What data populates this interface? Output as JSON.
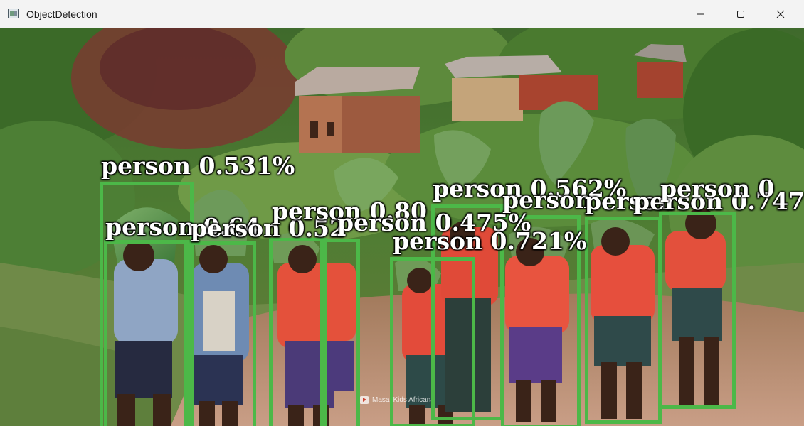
{
  "window": {
    "title": "ObjectDetection",
    "icon": "app-icon",
    "controls": [
      "minimize-icon",
      "maximize-icon",
      "close-icon"
    ]
  },
  "video": {
    "watermark": "Masai Kids Africana"
  },
  "detections": [
    {
      "label": "person 0.531%"
    },
    {
      "label": "person 0.64"
    },
    {
      "label": "person 0.52"
    },
    {
      "label": "person 0.80"
    },
    {
      "label": "person 0.475%"
    },
    {
      "label": "person 0.721%"
    },
    {
      "label": "person 0.562%"
    },
    {
      "label": "person"
    },
    {
      "label": "person"
    },
    {
      "label": "person 0.747%"
    },
    {
      "label": "person 0"
    }
  ],
  "colors": {
    "box": "#4cb848",
    "label_text": "#ffffff"
  }
}
